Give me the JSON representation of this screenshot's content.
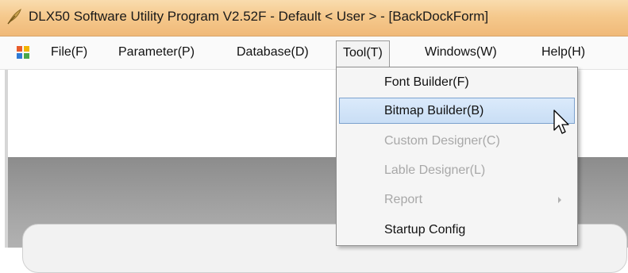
{
  "window": {
    "title": "DLX50 Software Utility Program V2.52F - Default < User >  - [BackDockForm]",
    "icon": "feather-app-icon"
  },
  "menubar": {
    "icon": "mdi-window-icon",
    "items": [
      {
        "label": "File(F)"
      },
      {
        "label": "Parameter(P)"
      },
      {
        "label": "Database(D)"
      },
      {
        "label": "Tool(T)",
        "open": true
      },
      {
        "label": "Windows(W)"
      },
      {
        "label": "Help(H)"
      }
    ]
  },
  "tool_menu": {
    "items": [
      {
        "label": "Font Builder(F)",
        "enabled": true
      },
      {
        "label": "Bitmap Builder(B)",
        "enabled": true,
        "highlighted": true
      },
      {
        "label": "Custom Designer(C)",
        "enabled": false
      },
      {
        "label": "Lable Designer(L)",
        "enabled": false
      },
      {
        "label": "Report",
        "enabled": false,
        "has_submenu": true
      },
      {
        "label": "Startup Config",
        "enabled": true
      }
    ]
  },
  "colors": {
    "titlebar": "#f5c98d",
    "highlight": "#c9def5",
    "highlight_border": "#7da2ce",
    "disabled_text": "#a8a8a8"
  }
}
